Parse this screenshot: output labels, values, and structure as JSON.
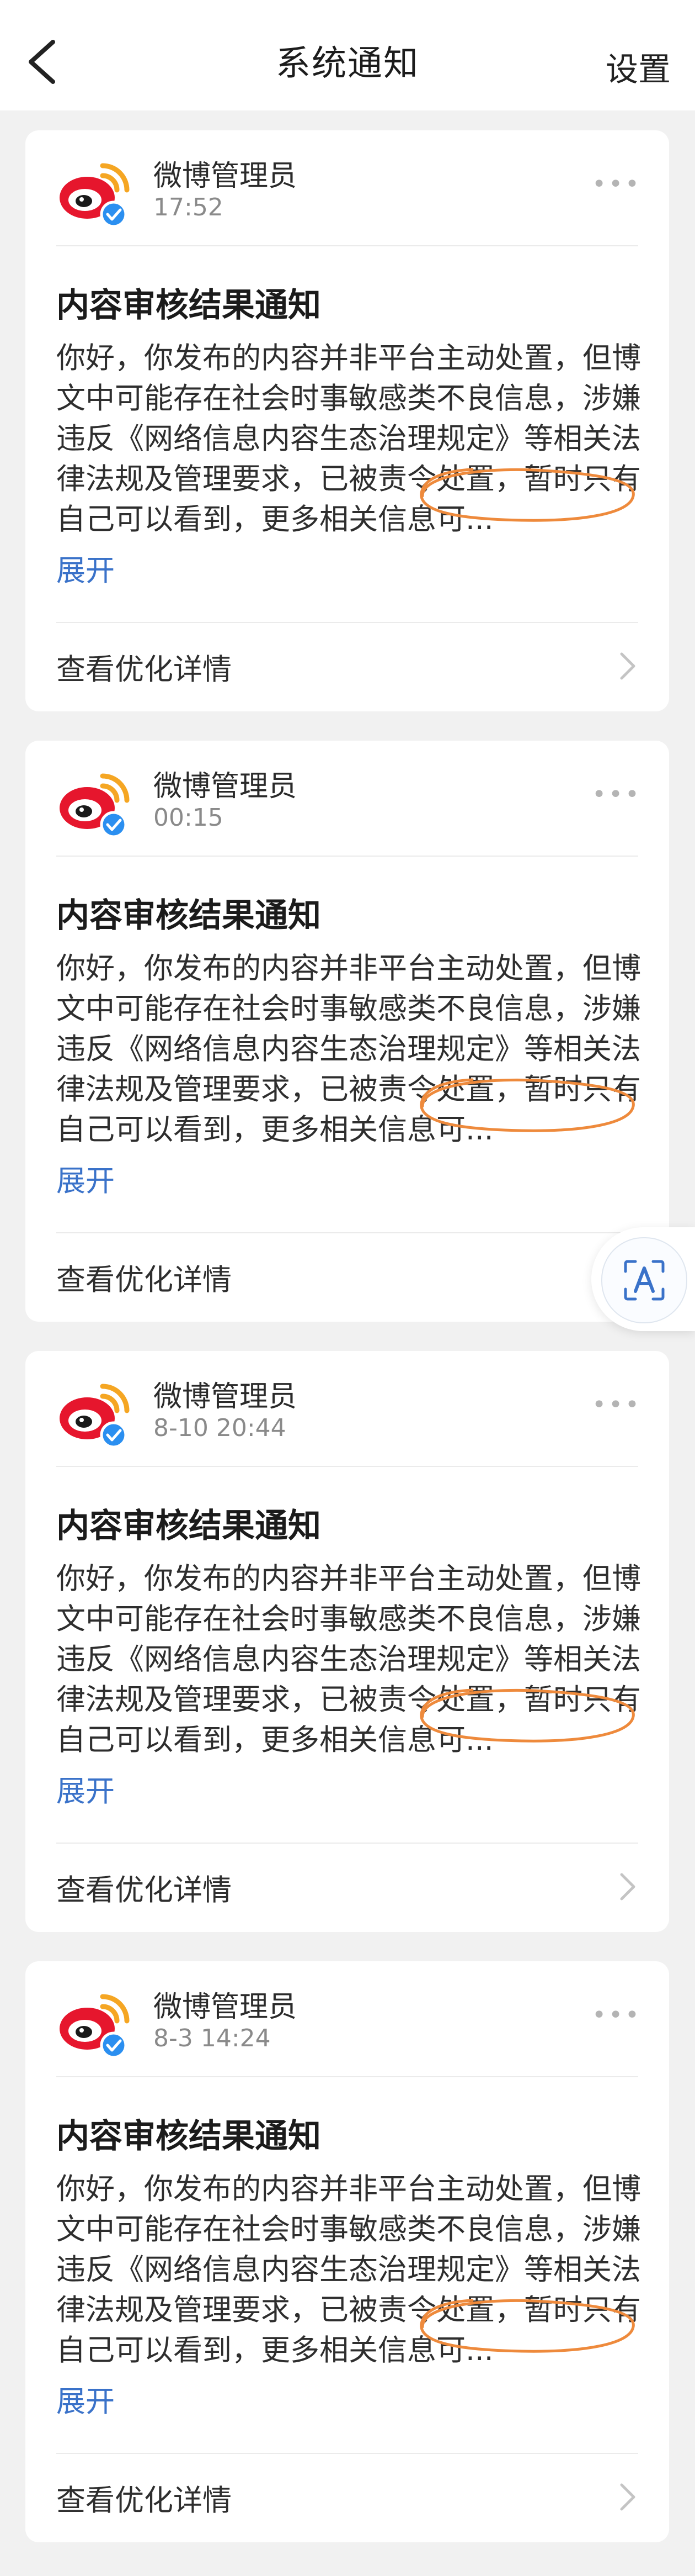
{
  "header": {
    "title": "系统通知",
    "settings_label": "设置"
  },
  "notifications": [
    {
      "sender": "微博管理员",
      "time": "17:52",
      "title": "内容审核结果通知",
      "body": "你好，你发布的内容并非平台主动处置，但博文中可能存在社会时事敏感类不良信息，涉嫌违反《网络信息内容生态治理规定》等相关法律法规及管理要求，已被责令处置，暂时只有自己可以看到，更多相关信息可...",
      "expand_label": "展开",
      "detail_label": "查看优化详情"
    },
    {
      "sender": "微博管理员",
      "time": "00:15",
      "title": "内容审核结果通知",
      "body": "你好，你发布的内容并非平台主动处置，但博文中可能存在社会时事敏感类不良信息，涉嫌违反《网络信息内容生态治理规定》等相关法律法规及管理要求，已被责令处置，暂时只有自己可以看到，更多相关信息可...",
      "expand_label": "展开",
      "detail_label": "查看优化详情"
    },
    {
      "sender": "微博管理员",
      "time": "8-10 20:44",
      "title": "内容审核结果通知",
      "body": "你好，你发布的内容并非平台主动处置，但博文中可能存在社会时事敏感类不良信息，涉嫌违反《网络信息内容生态治理规定》等相关法律法规及管理要求，已被责令处置，暂时只有自己可以看到，更多相关信息可...",
      "expand_label": "展开",
      "detail_label": "查看优化详情"
    },
    {
      "sender": "微博管理员",
      "time": "8-3 14:24",
      "title": "内容审核结果通知",
      "body": "你好，你发布的内容并非平台主动处置，但博文中可能存在社会时事敏感类不良信息，涉嫌违反《网络信息内容生态治理规定》等相关法律法规及管理要求，已被责令处置，暂时只有自己可以看到，更多相关信息可...",
      "expand_label": "展开",
      "detail_label": "查看优化详情"
    }
  ],
  "icons": {
    "back": "back-arrow-icon",
    "avatar": "weibo-logo-icon",
    "verified": "verified-badge-icon",
    "more": "more-dots-icon",
    "chevron": "chevron-right-icon",
    "float": "text-recognition-icon"
  },
  "colors": {
    "background": "#f1f1f1",
    "card": "#ffffff",
    "link": "#3a72c9",
    "weibo_red": "#e6162d",
    "weibo_orange": "#f5a623",
    "verified_blue": "#2b8ff0",
    "annotation_orange": "#ee8a3c"
  }
}
